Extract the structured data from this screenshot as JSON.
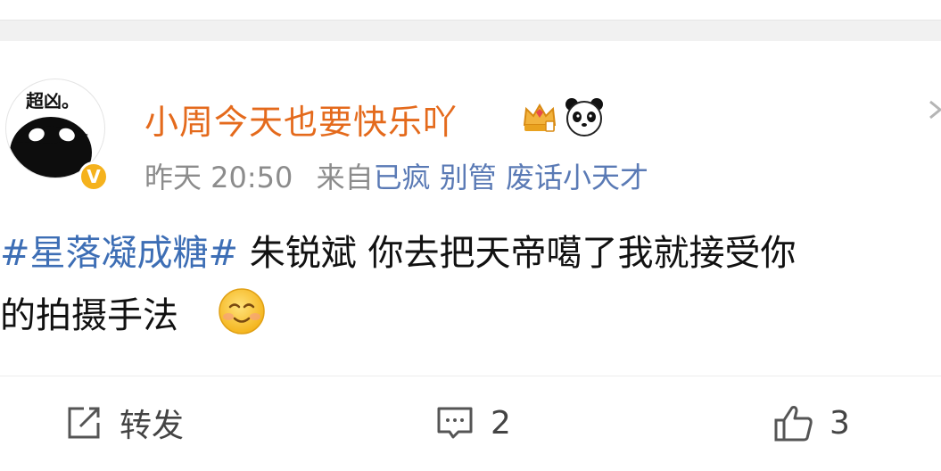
{
  "post": {
    "avatar_text": "超凶。",
    "verified_badge": "V",
    "username": "小周今天也要快乐吖",
    "icons": [
      "crown-icon",
      "panda-icon",
      "more-icon"
    ],
    "time": "昨天 20:50",
    "from_label": "来自",
    "source": "已疯 别管 废话小天才",
    "topic": "#星落凝成糖#",
    "text_line1_rest": " 朱锐斌  你去把天帝噶了我就接受你",
    "text_line2": "的拍摄手法",
    "emoji": "smile-icon"
  },
  "actions": {
    "repost_label": "转发",
    "comment_count": "2",
    "like_count": "3"
  },
  "colors": {
    "username": "#e46a1c",
    "topic": "#3d6eb5",
    "source": "#5a7ab5",
    "meta": "#8c8c8c",
    "badge": "#f5b21d"
  }
}
